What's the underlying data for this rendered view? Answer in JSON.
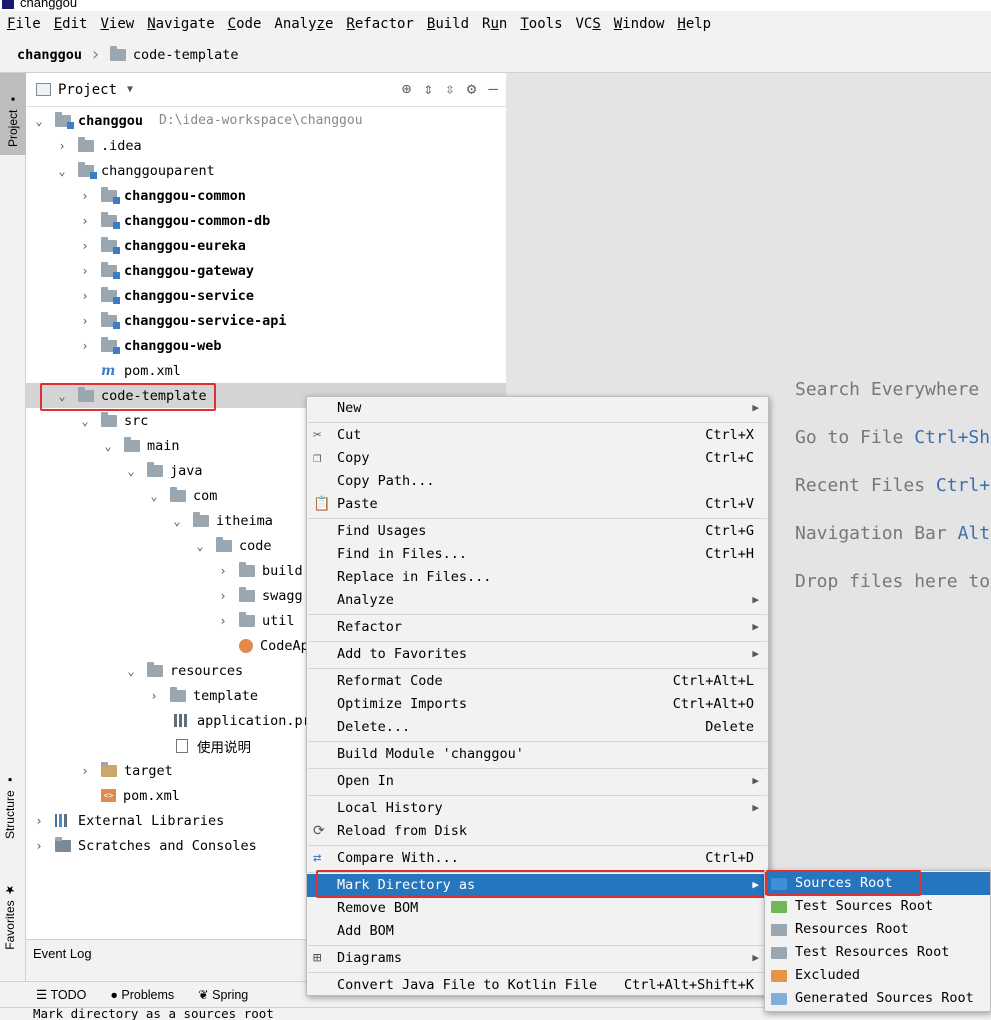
{
  "window": {
    "title": "changgou"
  },
  "menubar": [
    "File",
    "Edit",
    "View",
    "Navigate",
    "Code",
    "Analyze",
    "Refactor",
    "Build",
    "Run",
    "Tools",
    "VCS",
    "Window",
    "Help"
  ],
  "breadcrumb": {
    "project": "changgou",
    "folder": "code-template"
  },
  "sidetabs": {
    "project": "Project",
    "structure": "Structure",
    "favorites": "Favorites"
  },
  "panel": {
    "title": "Project"
  },
  "tree": [
    {
      "label": "changgou",
      "path": "D:\\idea-workspace\\changgou"
    },
    {
      "label": ".idea"
    },
    {
      "label": "changgouparent"
    },
    {
      "label": "changgou-common"
    },
    {
      "label": "changgou-common-db"
    },
    {
      "label": "changgou-eureka"
    },
    {
      "label": "changgou-gateway"
    },
    {
      "label": "changgou-service"
    },
    {
      "label": "changgou-service-api"
    },
    {
      "label": "changgou-web"
    },
    {
      "label": "pom.xml"
    },
    {
      "label": "code-template"
    },
    {
      "label": "src"
    },
    {
      "label": "main"
    },
    {
      "label": "java"
    },
    {
      "label": "com"
    },
    {
      "label": "itheima"
    },
    {
      "label": "code"
    },
    {
      "label": "build"
    },
    {
      "label": "swagg"
    },
    {
      "label": "util"
    },
    {
      "label": "CodeAppl"
    },
    {
      "label": "resources"
    },
    {
      "label": "template"
    },
    {
      "label": "application.pr"
    },
    {
      "label": "使用说明"
    },
    {
      "label": "target"
    },
    {
      "label": "pom.xml"
    },
    {
      "label": "External Libraries"
    },
    {
      "label": "Scratches and Consoles"
    }
  ],
  "editor_hints": [
    {
      "text": "Search Everywhere",
      "key": ""
    },
    {
      "text": "Go to File",
      "key": "Ctrl+Sh"
    },
    {
      "text": "Recent Files",
      "key": "Ctrl+"
    },
    {
      "text": "Navigation Bar",
      "key": "Alt"
    },
    {
      "text": "Drop files here to",
      "key": ""
    }
  ],
  "context_menu": [
    {
      "label": "New",
      "shortcut": ""
    },
    {
      "label": "Cut",
      "shortcut": "Ctrl+X"
    },
    {
      "label": "Copy",
      "shortcut": "Ctrl+C"
    },
    {
      "label": "Copy Path...",
      "shortcut": ""
    },
    {
      "label": "Paste",
      "shortcut": "Ctrl+V"
    },
    {
      "label": "Find Usages",
      "shortcut": "Ctrl+G"
    },
    {
      "label": "Find in Files...",
      "shortcut": "Ctrl+H"
    },
    {
      "label": "Replace in Files...",
      "shortcut": ""
    },
    {
      "label": "Analyze",
      "shortcut": ""
    },
    {
      "label": "Refactor",
      "shortcut": ""
    },
    {
      "label": "Add to Favorites",
      "shortcut": ""
    },
    {
      "label": "Reformat Code",
      "shortcut": "Ctrl+Alt+L"
    },
    {
      "label": "Optimize Imports",
      "shortcut": "Ctrl+Alt+O"
    },
    {
      "label": "Delete...",
      "shortcut": "Delete"
    },
    {
      "label": "Build Module 'changgou'",
      "shortcut": ""
    },
    {
      "label": "Open In",
      "shortcut": ""
    },
    {
      "label": "Local History",
      "shortcut": ""
    },
    {
      "label": "Reload from Disk",
      "shortcut": ""
    },
    {
      "label": "Compare With...",
      "shortcut": "Ctrl+D"
    },
    {
      "label": "Mark Directory as",
      "shortcut": ""
    },
    {
      "label": "Remove BOM",
      "shortcut": ""
    },
    {
      "label": "Add BOM",
      "shortcut": ""
    },
    {
      "label": "Diagrams",
      "shortcut": ""
    },
    {
      "label": "Convert Java File to Kotlin File",
      "shortcut": "Ctrl+Alt+Shift+K"
    }
  ],
  "submenu": [
    {
      "label": "Sources Root",
      "color": "#3d8fd6"
    },
    {
      "label": "Test Sources Root",
      "color": "#6fb85a"
    },
    {
      "label": "Resources Root",
      "color": "#9aa7b0"
    },
    {
      "label": "Test Resources Root",
      "color": "#9aa7b0"
    },
    {
      "label": "Excluded",
      "color": "#e8934a"
    },
    {
      "label": "Generated Sources Root",
      "color": "#7fb0dc"
    }
  ],
  "event_log": "Event Log",
  "bottom_tabs": [
    "TODO",
    "Problems",
    "Spring"
  ],
  "status": "Mark directory as a sources root"
}
